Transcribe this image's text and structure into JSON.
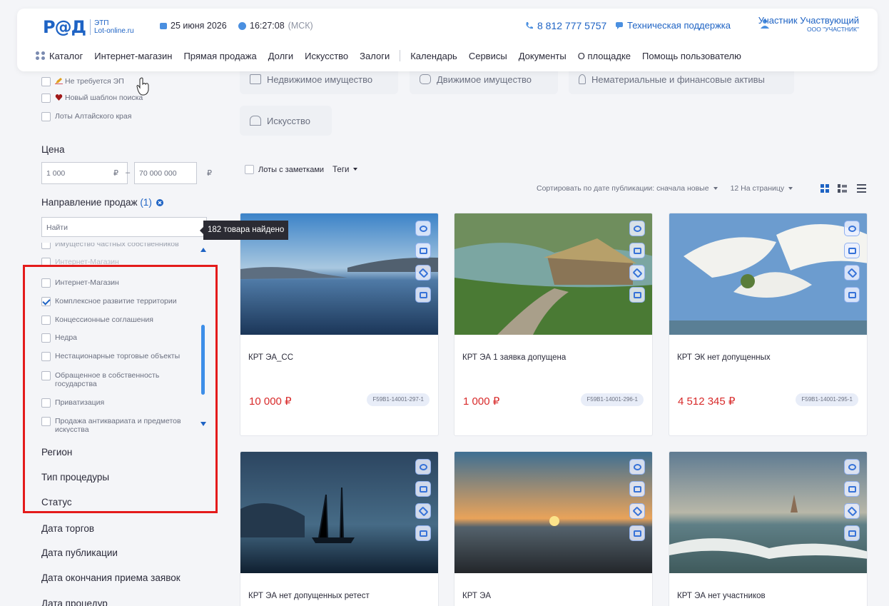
{
  "header": {
    "logo_text": "Р@Д",
    "logo_sub_1": "ЭТП",
    "logo_sub_2": "Lot-online.ru",
    "date": "25 июня 2026",
    "time": "16:27:08",
    "timezone": "(МСК)",
    "phone": "8 812 777 5757",
    "support": "Техническая поддержка",
    "user_name": "Участник Участвующий",
    "user_org": "ООО \"УЧАСТНИК\""
  },
  "nav": {
    "items": [
      "Каталог",
      "Интернет-магазин",
      "Прямая продажа",
      "Долги",
      "Искусство",
      "Залоги"
    ],
    "items2": [
      "Календарь",
      "Сервисы",
      "Документы",
      "О площадке",
      "Помощь пользователю"
    ]
  },
  "sidebar": {
    "top_checks": [
      "Не требуется ЭП",
      "Новый шаблон поиска",
      "Лоты Алтайского края"
    ],
    "price_title": "Цена",
    "price_from": "1 000",
    "price_to": "70 000 000",
    "currency": "₽",
    "direction_title": "Направление продаж",
    "direction_count": "(1)",
    "search_placeholder": "Найти",
    "list": [
      "Имущество частных собственников",
      "Интернет-Магазин",
      "Интернет-Магазин",
      "Комплексное развитие территории",
      "Концессионные соглашения",
      "Недра",
      "Нестационарные торговые объекты",
      "Обращенное в собственность государства",
      "Приватизация",
      "Продажа антиквариата и предметов искусства"
    ],
    "filters": [
      "Регион",
      "Тип процедуры",
      "Статус",
      "Дата торгов",
      "Дата публикации",
      "Дата окончания приема заявок",
      "Дата процедур"
    ],
    "tooltip": "182 товара найдено"
  },
  "categories": [
    "Недвижимое имущество",
    "Движимое имущество",
    "Нематериальные и финансовые активы",
    "Искусство"
  ],
  "toolbar": {
    "notes": "Лоты с заметками",
    "tags": "Теги",
    "sort": "Сортировать по дате публикации: сначала новые",
    "per_page": "12 На страницу"
  },
  "cards": [
    {
      "title": "КРТ ЭА_СС",
      "price": "10 000 ₽",
      "code": "F59B1-14001-297-1"
    },
    {
      "title": "КРТ ЭА 1 заявка допущена",
      "price": "1 000 ₽",
      "code": "F59B1-14001-296-1"
    },
    {
      "title": "КРТ ЭК нет допущенных",
      "price": "4 512 345 ₽",
      "code": "F59B1-14001-295-1"
    },
    {
      "title": "КРТ ЭА нет допущенных ретест",
      "price": "",
      "code": ""
    },
    {
      "title": "КРТ ЭА",
      "price": "",
      "code": ""
    },
    {
      "title": "КРТ ЭА нет участников",
      "price": "",
      "code": ""
    }
  ],
  "colors": {
    "accent": "#1e63c4",
    "price": "#d82a2a",
    "highlight": "#e41b1b"
  }
}
